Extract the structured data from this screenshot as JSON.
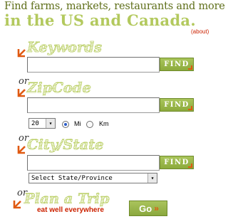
{
  "header": {
    "line1": "Find farms, markets, restaurants and more",
    "line2": "in the US and Canada.",
    "about_link": "(about)"
  },
  "keywords_section": {
    "title": "Keywords",
    "input_value": "",
    "find_label": "FIND"
  },
  "zipcode_section": {
    "or": "or",
    "title": "ZipCode",
    "input_value": "",
    "find_label": "FIND",
    "distance_select": "20",
    "unit_options": [
      {
        "label": "Mi",
        "checked": true
      },
      {
        "label": "Km",
        "checked": false
      }
    ]
  },
  "citystate_section": {
    "or": "or",
    "title": "City/State",
    "input_value": "",
    "find_label": "FIND",
    "state_select": "Select State/Province"
  },
  "trip_section": {
    "or": "or",
    "title": "Plan a Trip",
    "tagline": "eat well everywhere",
    "go_label": "Go"
  },
  "colors": {
    "accent_green": "#b3c95e",
    "button_green": "#8caa3c",
    "arrow_orange": "#e05a12",
    "link_red": "#cc2200"
  }
}
